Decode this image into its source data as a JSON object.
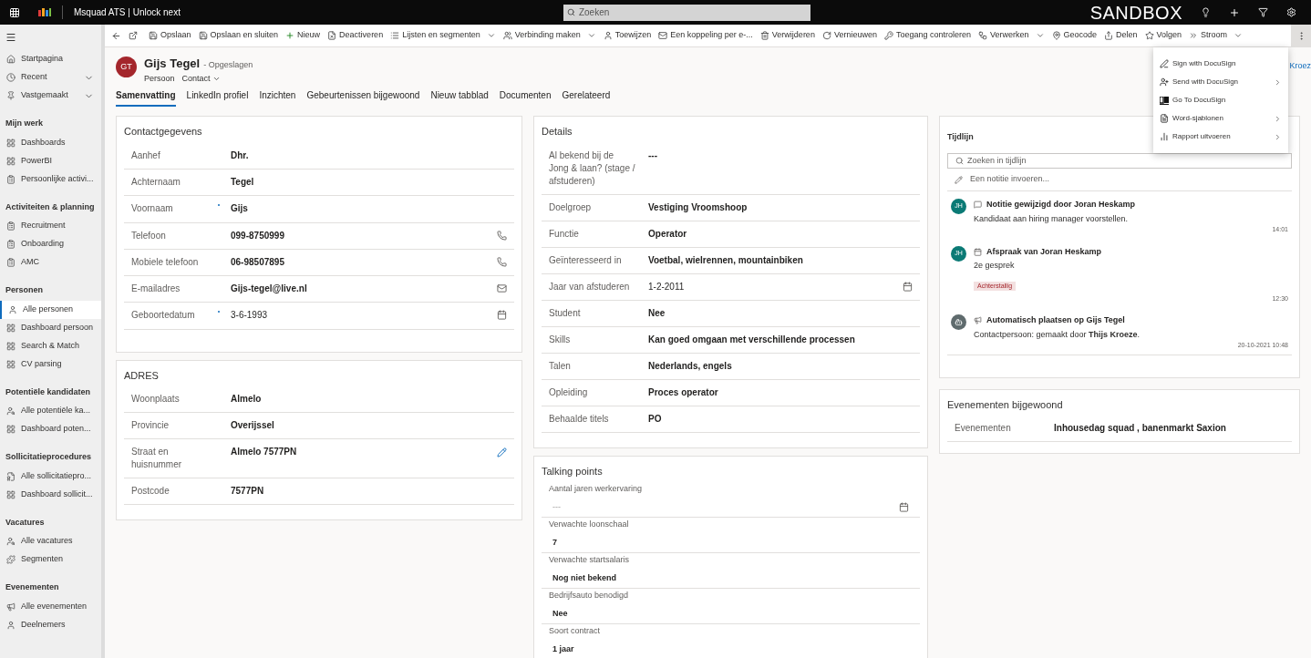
{
  "app_bar": {
    "title": "Msquad ATS | Unlock next",
    "search_placeholder": "Zoeken",
    "environment": "SANDBOX"
  },
  "commands": [
    {
      "label": "Opslaan",
      "kind": "save",
      "dropdown": false
    },
    {
      "label": "Opslaan en sluiten",
      "kind": "saveclose",
      "dropdown": false
    },
    {
      "label": "Nieuw",
      "kind": "new",
      "dropdown": false
    },
    {
      "label": "Deactiveren",
      "kind": "deactivate",
      "dropdown": false
    },
    {
      "label": "Lijsten en segmenten",
      "kind": "lists",
      "dropdown": true
    },
    {
      "label": "Verbinding maken",
      "kind": "connect",
      "dropdown": true
    },
    {
      "label": "Toewijzen",
      "kind": "assign",
      "dropdown": false
    },
    {
      "label": "Een koppeling per e-...",
      "kind": "mail",
      "dropdown": false
    },
    {
      "label": "Verwijderen",
      "kind": "delete",
      "dropdown": false
    },
    {
      "label": "Vernieuwen",
      "kind": "refresh",
      "dropdown": false
    },
    {
      "label": "Toegang controleren",
      "kind": "access",
      "dropdown": false
    },
    {
      "label": "Verwerken",
      "kind": "process",
      "dropdown": true
    },
    {
      "label": "Geocode",
      "kind": "geo",
      "dropdown": false
    },
    {
      "label": "Delen",
      "kind": "share",
      "dropdown": false
    },
    {
      "label": "Volgen",
      "kind": "follow",
      "dropdown": false
    },
    {
      "label": "Stroom",
      "kind": "flow",
      "dropdown": true
    }
  ],
  "more_menu": {
    "open": true,
    "items": [
      {
        "label": "Sign with DocuSign",
        "kind": "sign",
        "submenu": false
      },
      {
        "label": "Send with DocuSign",
        "kind": "send",
        "submenu": true
      },
      {
        "label": "Go To DocuSign",
        "kind": "ds",
        "submenu": false
      },
      {
        "label": "Word-sjablonen",
        "kind": "word",
        "submenu": true
      },
      {
        "label": "Rapport uitvoeren",
        "kind": "report",
        "submenu": true
      }
    ]
  },
  "sidebar": {
    "sections": [
      {
        "items": [
          {
            "label": "Startpagina",
            "kind": "home",
            "selected": false,
            "expandable": false
          },
          {
            "label": "Recent",
            "kind": "recent",
            "selected": false,
            "expandable": true
          },
          {
            "label": "Vastgemaakt",
            "kind": "pin",
            "selected": false,
            "expandable": true
          }
        ]
      },
      {
        "title": "Mijn werk",
        "items": [
          {
            "label": "Dashboards",
            "kind": "dash",
            "selected": false
          },
          {
            "label": "PowerBI",
            "kind": "dash",
            "selected": false
          },
          {
            "label": "Persoonlijke activi...",
            "kind": "activity",
            "selected": false
          }
        ]
      },
      {
        "title": "Activiteiten & planning",
        "items": [
          {
            "label": "Recruitment",
            "kind": "activity",
            "selected": false
          },
          {
            "label": "Onboarding",
            "kind": "activity",
            "selected": false
          },
          {
            "label": "AMC",
            "kind": "activity",
            "selected": false
          }
        ]
      },
      {
        "title": "Personen",
        "items": [
          {
            "label": "Alle personen",
            "kind": "person",
            "selected": true
          },
          {
            "label": "Dashboard persoon",
            "kind": "dash",
            "selected": false
          },
          {
            "label": "Search & Match",
            "kind": "dash",
            "selected": false
          },
          {
            "label": "CV parsing",
            "kind": "dash",
            "selected": false
          }
        ]
      },
      {
        "title": "Potentiële kandidaten",
        "items": [
          {
            "label": "Alle potentiële ka...",
            "kind": "prospect",
            "selected": false
          },
          {
            "label": "Dashboard poten...",
            "kind": "dash",
            "selected": false
          }
        ]
      },
      {
        "title": "Sollicitatieprocedures",
        "items": [
          {
            "label": "Alle sollicitatiepro...",
            "kind": "doc",
            "selected": false
          },
          {
            "label": "Dashboard sollicit...",
            "kind": "dash",
            "selected": false
          }
        ]
      },
      {
        "title": "Vacatures",
        "items": [
          {
            "label": "Alle vacatures",
            "kind": "prospect",
            "selected": false
          },
          {
            "label": "Segmenten",
            "kind": "segment",
            "selected": false
          }
        ]
      },
      {
        "title": "Evenementen",
        "items": [
          {
            "label": "Alle evenementen",
            "kind": "event",
            "selected": false
          },
          {
            "label": "Deelnemers",
            "kind": "person",
            "selected": false
          }
        ]
      }
    ]
  },
  "record": {
    "initials": "GT",
    "name": "Gijs Tegel",
    "status": "- Opgeslagen",
    "entity": "Persoon",
    "form": "Contact",
    "owner": "Kroez"
  },
  "tabs": [
    {
      "label": "Samenvatting",
      "selected": true
    },
    {
      "label": "LinkedIn profiel",
      "selected": false
    },
    {
      "label": "Inzichten",
      "selected": false
    },
    {
      "label": "Gebeurtenissen bijgewoond",
      "selected": false
    },
    {
      "label": "Nieuw tabblad",
      "selected": false
    },
    {
      "label": "Documenten",
      "selected": false
    },
    {
      "label": "Gerelateerd",
      "selected": false
    }
  ],
  "contact": {
    "title": "Contactgegevens",
    "fields": [
      {
        "label": "Aanhef",
        "value": "Dhr.",
        "required": false
      },
      {
        "label": "Achternaam",
        "value": "Tegel",
        "required": false
      },
      {
        "label": "Voornaam",
        "value": "Gijs",
        "required": true
      },
      {
        "label": "Telefoon",
        "value": "099-8750999",
        "kind": "phone",
        "required": false
      },
      {
        "label": "Mobiele telefoon",
        "value": "06-98507895",
        "kind": "phone",
        "required": false
      },
      {
        "label": "E-mailadres",
        "value": "Gijs-tegel@live.nl",
        "kind": "email",
        "required": false
      },
      {
        "label": "Geboortedatum",
        "value": "3-6-1993",
        "kind": "date",
        "required": true
      }
    ]
  },
  "address": {
    "title": "ADRES",
    "fields": [
      {
        "label": "Woonplaats",
        "value": "Almelo",
        "required": false
      },
      {
        "label": "Provincie",
        "value": "Overijssel",
        "required": false
      },
      {
        "label": "Straat en huisnummer",
        "value": "Almelo 7577PN",
        "kind": "edit",
        "required": false
      },
      {
        "label": "Postcode",
        "value": "7577PN",
        "required": false
      }
    ]
  },
  "details": {
    "title": "Details",
    "fields": [
      {
        "label": "Al bekend bij de Jong & laan? (stage / afstuderen)",
        "value": "---",
        "required": false
      },
      {
        "label": "Doelgroep",
        "value": "Vestiging Vroomshoop",
        "required": false
      },
      {
        "label": "Functie",
        "value": "Operator",
        "required": false
      },
      {
        "label": "Geïnteresseerd in",
        "value": "Voetbal, wielrennen, mountainbiken",
        "required": false
      },
      {
        "label": "Jaar van afstuderen",
        "value": "1-2-2011",
        "kind": "date",
        "required": false
      },
      {
        "label": "Student",
        "value": "Nee",
        "required": false
      },
      {
        "label": "Skills",
        "value": "Kan goed omgaan met verschillende processen",
        "required": false
      },
      {
        "label": "Talen",
        "value": "Nederlands, engels",
        "required": false
      },
      {
        "label": "Opleiding",
        "value": "Proces operator",
        "required": false
      },
      {
        "label": "Behaalde titels",
        "value": "PO",
        "required": false
      }
    ]
  },
  "talking_points": {
    "title": "Talking points",
    "fields": [
      {
        "label": "Aantal jaren werkervaring",
        "placeholder": "---",
        "kind": "date"
      },
      {
        "label": "Verwachte loonschaal",
        "value": "7"
      },
      {
        "label": "Verwachte startsalaris",
        "value": "Nog niet bekend"
      },
      {
        "label": "Bedrijfsauto benodigd",
        "value": "Nee"
      },
      {
        "label": "Soort contract",
        "value": "1 jaar"
      }
    ]
  },
  "timeline": {
    "title": "Tijdlijn",
    "search_placeholder": "Zoeken in tijdlijn",
    "note_placeholder": "Een notitie invoeren...",
    "entries": [
      {
        "kind": "note",
        "initials": "JH",
        "color": "#0b7a75",
        "title": "Notitie gewijzigd door Joran Heskamp",
        "text": "Kandidaat aan hiring manager voorstellen.",
        "time": "14:01"
      },
      {
        "kind": "appointment",
        "initials": "JH",
        "color": "#0b7a75",
        "title": "Afspraak van Joran Heskamp",
        "text": "2e gesprek",
        "badge": "Achterstallig",
        "time": "12:30"
      },
      {
        "kind": "post",
        "color": "#5f6b6d",
        "title": "Automatisch plaatsen op Gijs Tegel",
        "text": "Contactpersoon: gemaakt door **Thijs Kroeze**.",
        "time": "20-10-2021 10:48"
      }
    ]
  },
  "events": {
    "title": "Evenementen bijgewoond",
    "fields": [
      {
        "label": "Evenementen",
        "value": "Inhousedag squad , banenmarkt Saxion",
        "required": false
      }
    ]
  }
}
